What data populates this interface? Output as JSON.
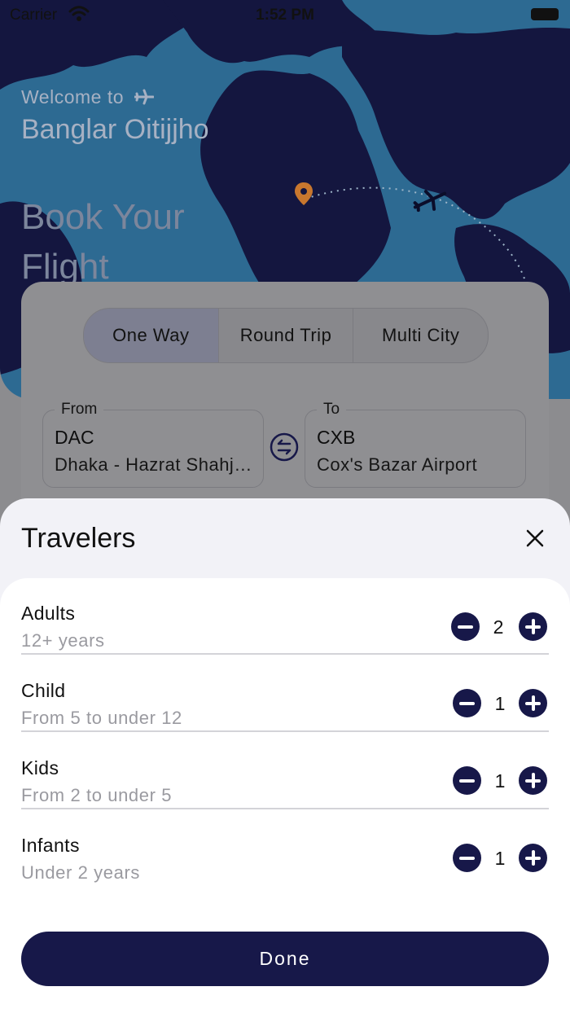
{
  "status_bar": {
    "carrier": "Carrier",
    "time": "1:52 PM"
  },
  "hero": {
    "welcome": "Welcome to",
    "app_name": "Banglar Oitijjho",
    "title": "Book Your Flight"
  },
  "trip_types": [
    {
      "label": "One Way",
      "selected": true
    },
    {
      "label": "Round Trip",
      "selected": false
    },
    {
      "label": "Multi City",
      "selected": false
    }
  ],
  "route": {
    "from": {
      "label": "From",
      "code": "DAC",
      "name": "Dhaka - Hazrat Shahjalal International Airport"
    },
    "to": {
      "label": "To",
      "code": "CXB",
      "name": "Cox's Bazar Airport"
    }
  },
  "travelers_sheet": {
    "title": "Travelers",
    "rows": [
      {
        "title": "Adults",
        "subtitle": "12+ years",
        "count": "2"
      },
      {
        "title": "Child",
        "subtitle": "From 5 to under 12",
        "count": "1"
      },
      {
        "title": "Kids",
        "subtitle": "From 2 to under 5",
        "count": "1"
      },
      {
        "title": "Infants",
        "subtitle": "Under 2 years",
        "count": "1"
      }
    ],
    "done_label": "Done"
  },
  "colors": {
    "primary": "#171849",
    "sheet_background": "#f2f2f7",
    "map_ocean": "#2d6a92",
    "map_land": "#14163f"
  },
  "icons": [
    "wifi-icon",
    "battery-icon",
    "airplane-icon",
    "map-pin-icon",
    "swap-icon",
    "close-icon",
    "minus-icon",
    "plus-icon"
  ]
}
